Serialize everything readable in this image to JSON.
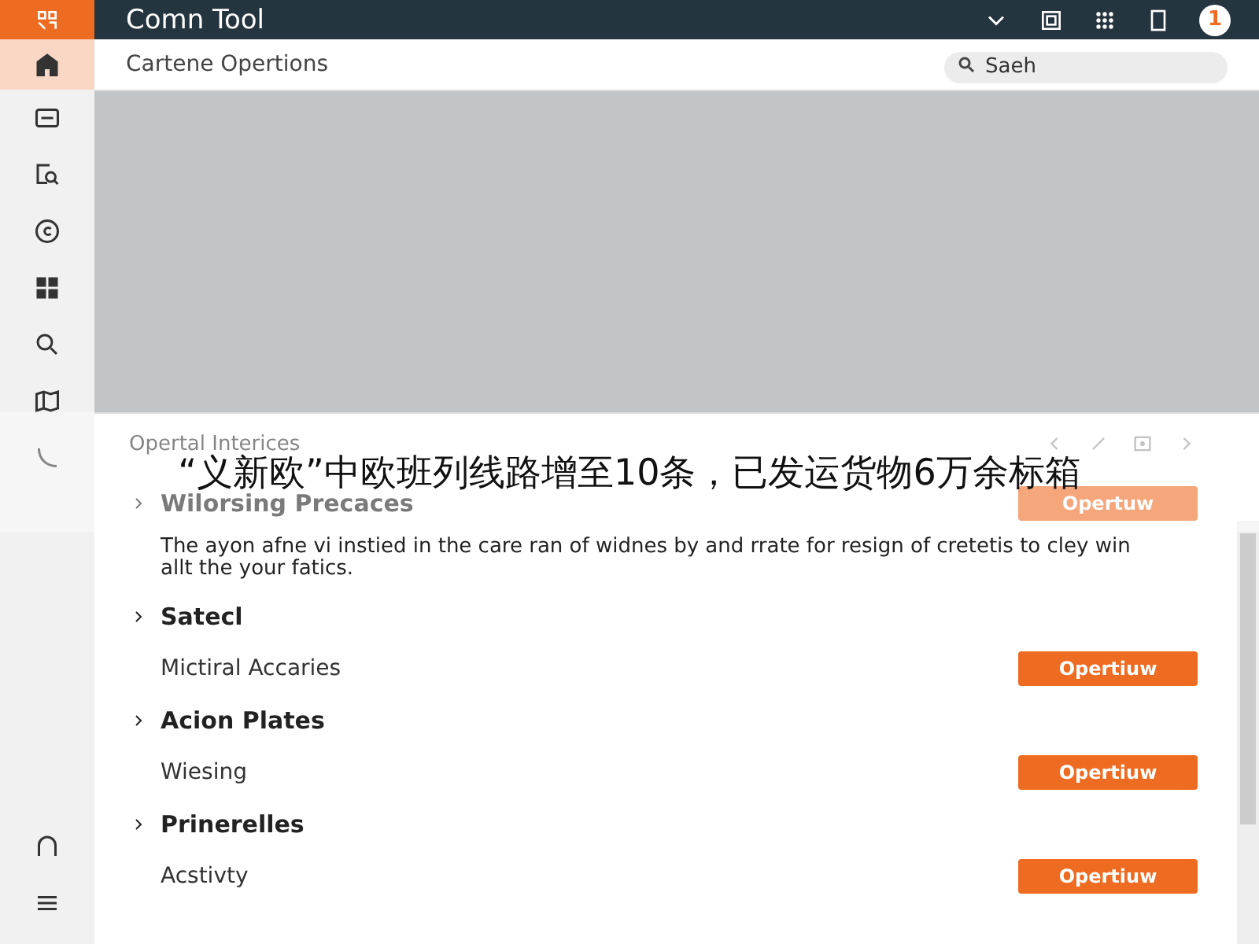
{
  "top_bar": {
    "title": "Comn Tool",
    "badge": "1"
  },
  "sidebar": {
    "items": [
      {
        "selected": true
      },
      {
        "selected": false
      },
      {
        "selected": false
      },
      {
        "selected": false
      },
      {
        "selected": false
      },
      {
        "selected": false
      },
      {
        "selected": false
      },
      {
        "selected": false
      }
    ],
    "bottom_items": [
      {
        "selected": false
      },
      {
        "selected": false
      }
    ]
  },
  "header": {
    "title": "Cartene Opertions",
    "search": {
      "placeholder": "Saeh"
    }
  },
  "panel": {
    "title": "Opertal Interices",
    "sections": [
      {
        "title": "Wilorsing Precaces",
        "button": "Opertuw",
        "description": "The ayon afne vi instied in the care ran of widnes by and rrate for resign of cretetis to cley win allt the your fatics."
      },
      {
        "title": "Satecl",
        "item": "Mictiral Accaries",
        "button": "Opertiuw"
      },
      {
        "title": "Acion Plates",
        "item": "Wiesing",
        "button": "Opertiuw"
      },
      {
        "title": "Prinerelles",
        "item": "Acstivty",
        "button": "Opertiuw"
      }
    ]
  },
  "caption": {
    "text": "“义新欧”中欧班列线路增至10条，已发运货物6万余标箱"
  }
}
